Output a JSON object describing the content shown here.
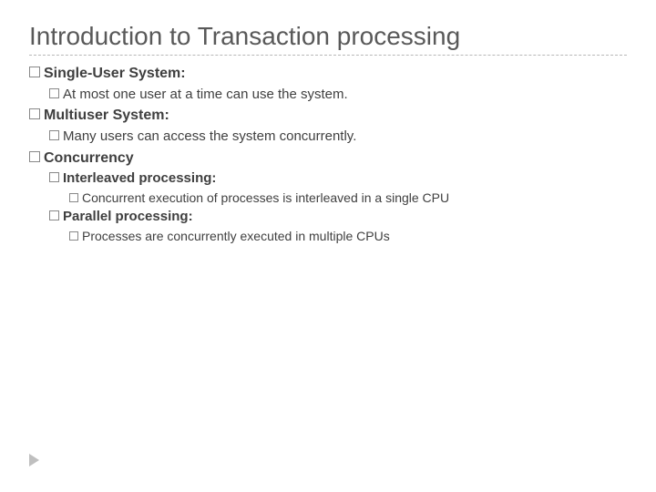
{
  "title": "Introduction to Transaction processing",
  "items": {
    "single_user_label": "Single-User System:",
    "single_user_desc_lead": "At ",
    "single_user_desc_rest": "most one user at a time can use the system.",
    "multiuser_label": "Multiuser System:",
    "multiuser_desc_lead": "Many ",
    "multiuser_desc_rest": "users can access the system concurrently.",
    "concurrency_label": "Concurrency",
    "interleaved_label": "Interleaved processing:",
    "interleaved_desc_lead": "Concurrent ",
    "interleaved_desc_rest": "execution of processes is interleaved in a single CPU",
    "parallel_label": "Parallel processing:",
    "parallel_desc_lead": "Processes ",
    "parallel_desc_rest": "are concurrently executed in multiple CPUs"
  }
}
